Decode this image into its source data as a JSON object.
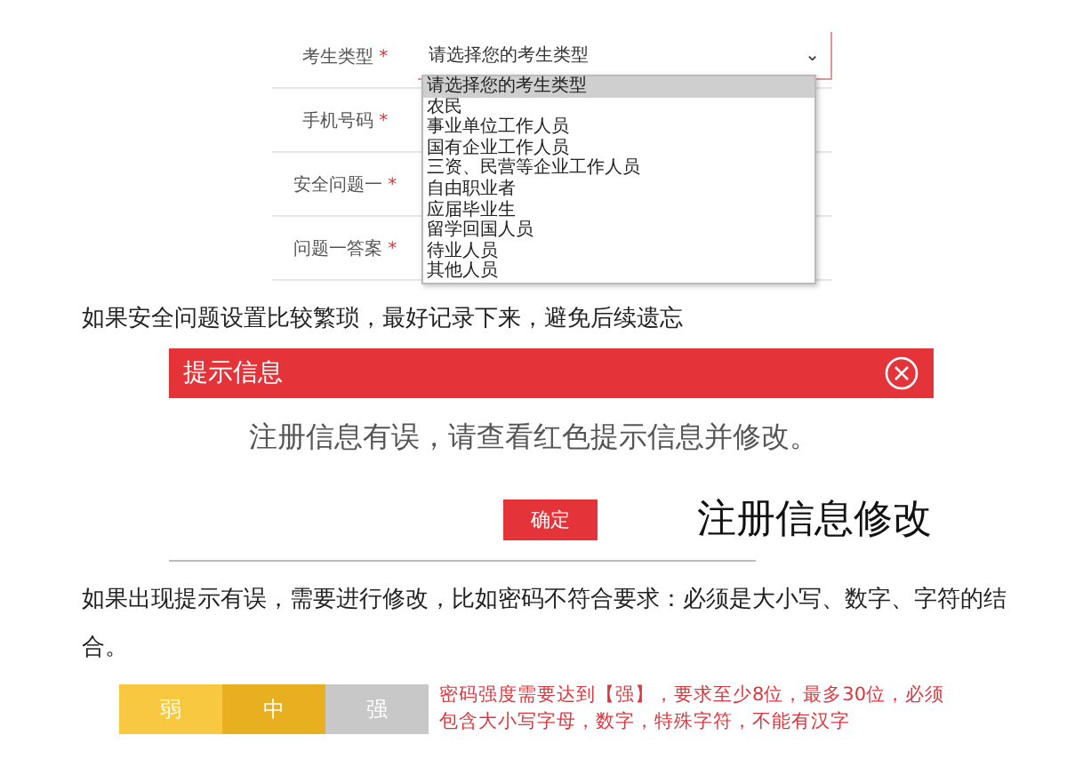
{
  "form": {
    "rows": [
      {
        "label": "考生类型",
        "mark": "*"
      },
      {
        "label": "手机号码",
        "mark": "*"
      },
      {
        "label": "安全问题一",
        "mark": "*"
      },
      {
        "label": "问题一答案",
        "mark": "*"
      }
    ],
    "select": {
      "value": "请选择您的考生类型",
      "caret": "⌄"
    },
    "options": [
      {
        "label": "请选择您的考生类型",
        "selected": true
      },
      {
        "label": "农民",
        "selected": false
      },
      {
        "label": "事业单位工作人员",
        "selected": false
      },
      {
        "label": "国有企业工作人员",
        "selected": false
      },
      {
        "label": "三资、民营等企业工作人员",
        "selected": false
      },
      {
        "label": "自由职业者",
        "selected": false
      },
      {
        "label": "应届毕业生",
        "selected": false
      },
      {
        "label": "留学回国人员",
        "selected": false
      },
      {
        "label": "待业人员",
        "selected": false
      },
      {
        "label": "其他人员",
        "selected": false
      }
    ]
  },
  "note_1": "如果安全问题设置比较繁琐，最好记录下来，避免后续遗忘",
  "dialog": {
    "title": "提示信息",
    "message": "注册信息有误，请查看红色提示信息并修改。",
    "button": "确定"
  },
  "caption": "注册信息修改",
  "note_2": "如果出现提示有误，需要进行修改，比如密码不符合要求：必须是大小写、数字、字符的结合。",
  "strength": {
    "levels": [
      {
        "label": "弱",
        "color": "#f8c840"
      },
      {
        "label": "中",
        "color": "#e8b020"
      },
      {
        "label": "强",
        "color": "#c8c8c8"
      }
    ],
    "hint": "密码强度需要达到【强】，要求至少8位，最多30位，必须包含大小写字母，数字，特殊字符，不能有汉字"
  }
}
